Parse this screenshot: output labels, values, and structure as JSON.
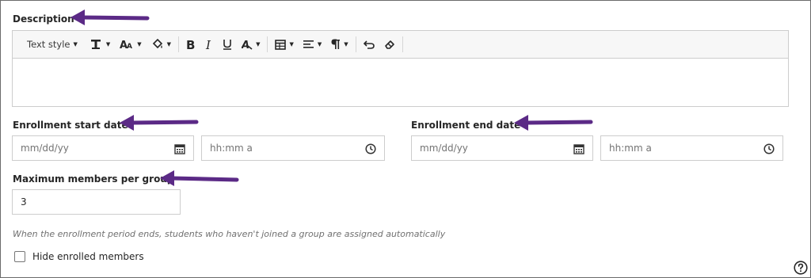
{
  "description": {
    "label": "Description",
    "toolbar": {
      "text_style": "Text style",
      "buttons": [
        "text-format-icon",
        "font-size-icon",
        "highlight-icon",
        "bold-icon",
        "italic-icon",
        "underline-icon",
        "text-color-icon",
        "table-icon",
        "align-icon",
        "paragraph-icon",
        "undo-icon",
        "eraser-icon"
      ]
    }
  },
  "enrollment_start": {
    "label": "Enrollment start date",
    "date_placeholder": "mm/dd/yy",
    "time_placeholder": "hh:mm a"
  },
  "enrollment_end": {
    "label": "Enrollment end date",
    "date_placeholder": "mm/dd/yy",
    "time_placeholder": "hh:mm a"
  },
  "max_members": {
    "label": "Maximum members per group",
    "value": "3"
  },
  "helper_text": "When the enrollment period ends, students who haven't joined a group are assigned automatically",
  "hide_enrolled": {
    "label": "Hide enrolled members",
    "checked": false
  },
  "annotation_color": "#5b2a86"
}
